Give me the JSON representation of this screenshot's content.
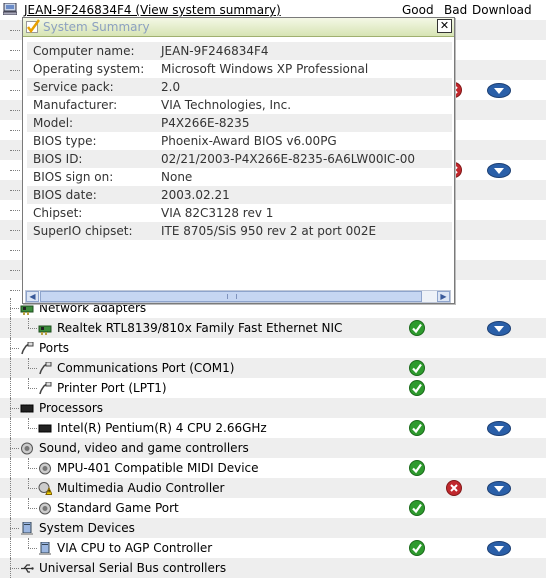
{
  "header": {
    "title": "JEAN-9F246834F4 (View system summary)",
    "col_good": "Good",
    "col_bad": "Bad",
    "col_download": "Download"
  },
  "popup": {
    "title": "System Summary",
    "close": "✕",
    "rows": [
      {
        "key": "Computer name:",
        "value": "JEAN-9F246834F4"
      },
      {
        "key": "Operating system:",
        "value": "Microsoft Windows XP Professional"
      },
      {
        "key": "Service pack:",
        "value": "2.0"
      },
      {
        "key": "Manufacturer:",
        "value": "VIA Technologies, Inc."
      },
      {
        "key": "Model:",
        "value": "P4X266E-8235"
      },
      {
        "key": "BIOS type:",
        "value": "Phoenix-Award BIOS v6.00PG"
      },
      {
        "key": "BIOS ID:",
        "value": "02/21/2003-P4X266E-8235-6A6LW00IC-00"
      },
      {
        "key": "BIOS sign on:",
        "value": "None"
      },
      {
        "key": "BIOS date:",
        "value": "2003.02.21"
      },
      {
        "key": "Chipset:",
        "value": "VIA 82C3128 rev 1"
      },
      {
        "key": "SuperIO chipset:",
        "value": "ITE 8705/SiS 950 rev 2 at port 002E"
      }
    ]
  },
  "tree": [
    {
      "label": "Network adapters",
      "level": 0,
      "icon": "network-icon",
      "status": null,
      "download": false
    },
    {
      "label": "Realtek RTL8139/810x Family Fast Ethernet NIC",
      "level": 1,
      "icon": "network-card-icon",
      "status": "good",
      "download": true
    },
    {
      "label": "Ports",
      "level": 0,
      "icon": "port-icon",
      "status": null,
      "download": false
    },
    {
      "label": "Communications Port (COM1)",
      "level": 1,
      "icon": "port-icon",
      "status": "good",
      "download": false
    },
    {
      "label": "Printer Port (LPT1)",
      "level": 1,
      "icon": "port-icon",
      "status": "good",
      "download": false
    },
    {
      "label": "Processors",
      "level": 0,
      "icon": "cpu-icon",
      "status": null,
      "download": false
    },
    {
      "label": "Intel(R) Pentium(R) 4 CPU 2.66GHz",
      "level": 1,
      "icon": "cpu-icon",
      "status": "good",
      "download": true
    },
    {
      "label": "Sound, video and game controllers",
      "level": 0,
      "icon": "speaker-icon",
      "status": null,
      "download": false
    },
    {
      "label": "MPU-401 Compatible MIDI Device",
      "level": 1,
      "icon": "speaker-icon",
      "status": "good",
      "download": false
    },
    {
      "label": "Multimedia Audio Controller",
      "level": 1,
      "icon": "speaker-warning-icon",
      "status": "bad",
      "download": true
    },
    {
      "label": "Standard Game Port",
      "level": 1,
      "icon": "speaker-icon",
      "status": "good",
      "download": false
    },
    {
      "label": "System Devices",
      "level": 0,
      "icon": "system-device-icon",
      "status": null,
      "download": false
    },
    {
      "label": "VIA CPU to AGP Controller",
      "level": 1,
      "icon": "system-device-icon",
      "status": "good",
      "download": true
    },
    {
      "label": "Universal Serial Bus controllers",
      "level": 0,
      "icon": "usb-icon",
      "status": null,
      "download": false
    }
  ],
  "hidden_rows_status": [
    {
      "bad": false,
      "download": false
    },
    {
      "bad": false,
      "download": false
    },
    {
      "bad": false,
      "download": false
    },
    {
      "bad": true,
      "download": true
    },
    {
      "bad": false,
      "download": false
    },
    {
      "bad": false,
      "download": false
    },
    {
      "bad": false,
      "download": false
    },
    {
      "bad": true,
      "download": true
    },
    {
      "bad": false,
      "download": false
    },
    {
      "bad": false,
      "download": false
    },
    {
      "bad": false,
      "download": false
    },
    {
      "bad": false,
      "download": false
    },
    {
      "bad": false,
      "download": false
    },
    {
      "bad": false,
      "download": false
    }
  ],
  "colors": {
    "good": "#2e9a2e",
    "bad": "#c0282d",
    "download": "#2a5fa8",
    "row_alt": "#eeeeee"
  }
}
